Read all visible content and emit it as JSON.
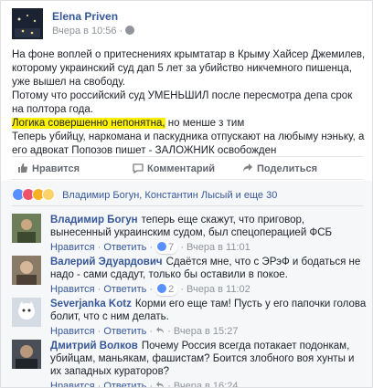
{
  "post": {
    "author": "Elena Priven",
    "time": "Вчера в 10:56 ·",
    "paragraphs": [
      "На фоне воплей о притеснениях крымтатар в Крыму Хайсер Джемилев, которому украинский суд дап 5 лет за убийство никчемного пишенца, уже вышел на свободу.",
      "Потому что российский суд УМЕНЬШИЛ после пересмотра депа срок на полтора года."
    ],
    "highlight": "Логика совершенно непонятна,",
    "after_highlight": " но менше з тим",
    "paragraph_last": "Теперь убийцу, наркомана и паскудника отпускают на любыму нэньку, а его адвокат Попозов пишет - ЗАЛОЖНИК освобожден"
  },
  "actions": {
    "like": "Нравится",
    "comment": "Комментарий",
    "share": "Поделиться"
  },
  "reactions": {
    "text": "Владимир Богун, Константин Лысый и еще 30",
    "colors": [
      "#5890ff",
      "#f25268",
      "#fcd36b",
      "#fcd36b"
    ]
  },
  "comments": [
    {
      "name": "Владимир Богун",
      "text": "теперь еще скажут, что приговор, вынесенный украинским судом, был спецоперацией ФСБ",
      "like": "Нравится",
      "reply": "Ответить",
      "likes": "7",
      "time": "Вчера в 11:01"
    },
    {
      "name": "Валерий Эдуардович",
      "text": "Сдаётся мне, что с ЭРэФ и бодаться не надо - сами сдадут, только бы оставили в покое.",
      "like": "Нравится",
      "reply": "Ответить",
      "likes": "2",
      "time": "Вчера в 11:02"
    },
    {
      "name": "Severjanka Kotz",
      "text": "Корми его еще там! Пусть у его папочки голова болит, что с ним делать.",
      "like": "Нравится",
      "reply": "Ответить",
      "likes": "",
      "time": "Вчера в 15:27"
    },
    {
      "name": "Дмитрий Волков",
      "text": "Почему Россия всегда потакает подонкам, убийцам, маньякам, фашистам? Боится злобного воя хунты и их западных кураторов?",
      "like": "Нравится",
      "reply": "Ответить",
      "likes": "",
      "time": "Вчера в 16:24"
    }
  ]
}
